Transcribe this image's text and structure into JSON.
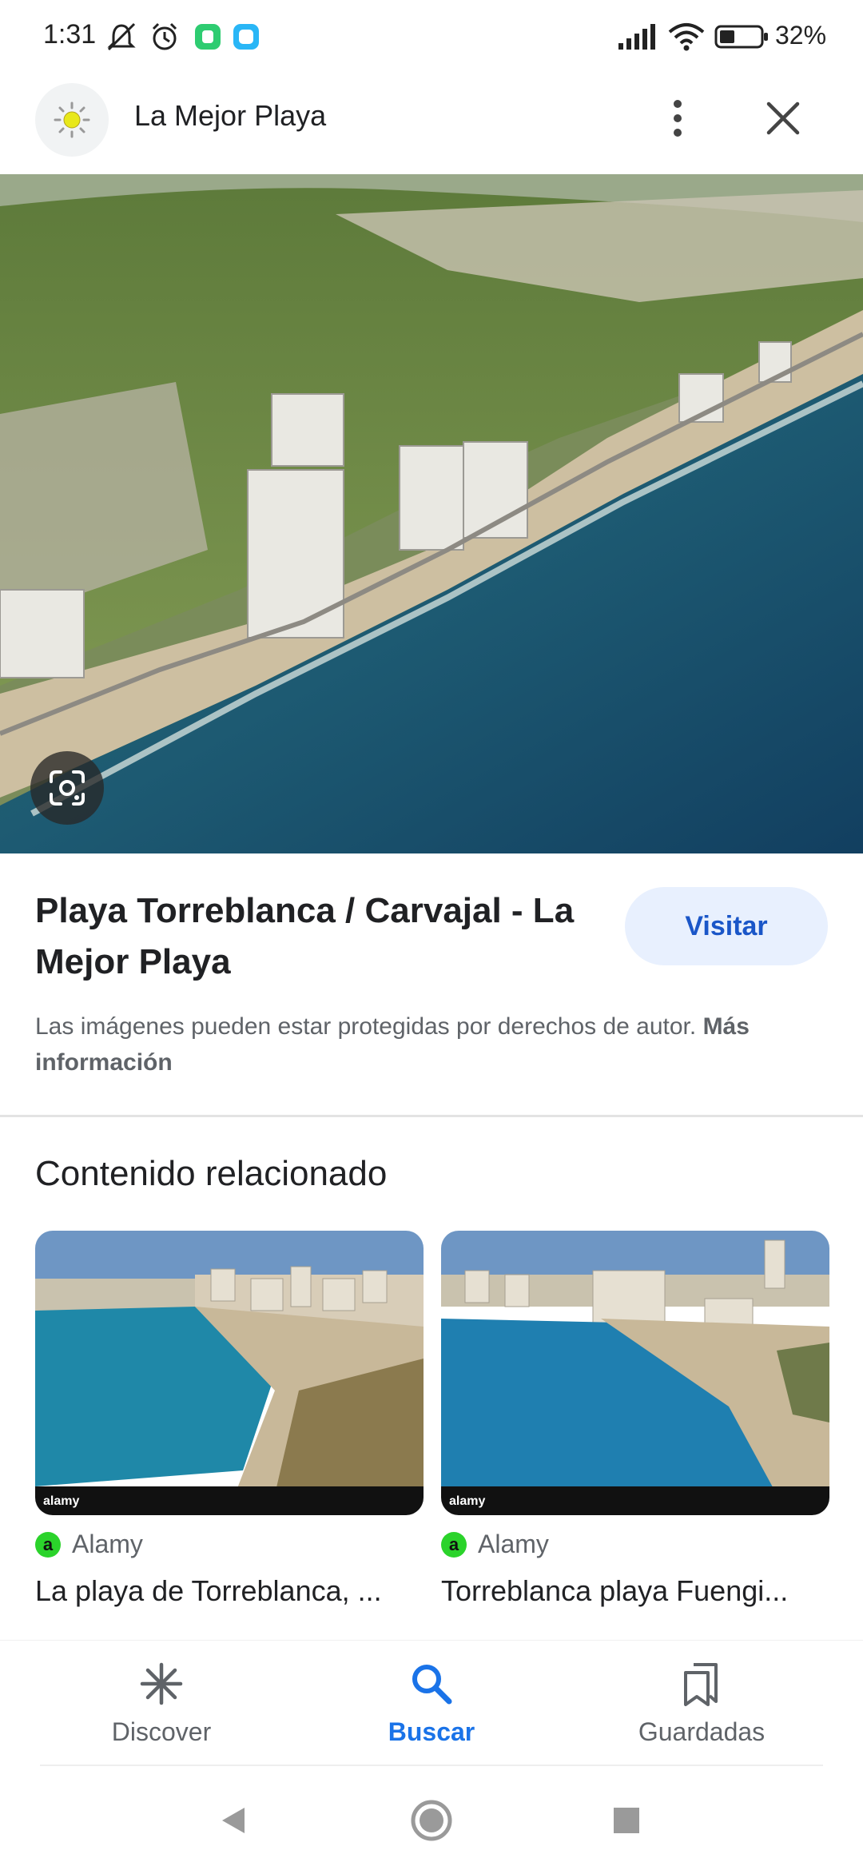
{
  "status_bar": {
    "time": "1:31",
    "battery_percent": "32%"
  },
  "header": {
    "title": "La Mejor Playa"
  },
  "result": {
    "title": "Playa Torreblanca / Carvajal - La Mejor Playa",
    "visit_label": "Visitar",
    "copyright_text": "Las imágenes pueden estar protegidas por derechos de autor. ",
    "more_info_label": "Más información"
  },
  "related": {
    "heading": "Contenido relacionado",
    "items": [
      {
        "source": "Alamy",
        "source_logo": "a",
        "title": "La playa de Torreblanca, ..."
      },
      {
        "source": "Alamy",
        "source_logo": "a",
        "title": "Torreblanca playa Fuengi..."
      }
    ]
  },
  "bottom_nav": {
    "items": [
      {
        "label": "Discover",
        "icon": "asterisk-icon",
        "active": false
      },
      {
        "label": "Buscar",
        "icon": "search-icon",
        "active": true
      },
      {
        "label": "Guardadas",
        "icon": "bookmarks-icon",
        "active": false
      }
    ]
  },
  "colors": {
    "accent": "#1a73e8",
    "visit_button_bg": "#e8f0fe",
    "source_logo": "#2bd32b"
  }
}
